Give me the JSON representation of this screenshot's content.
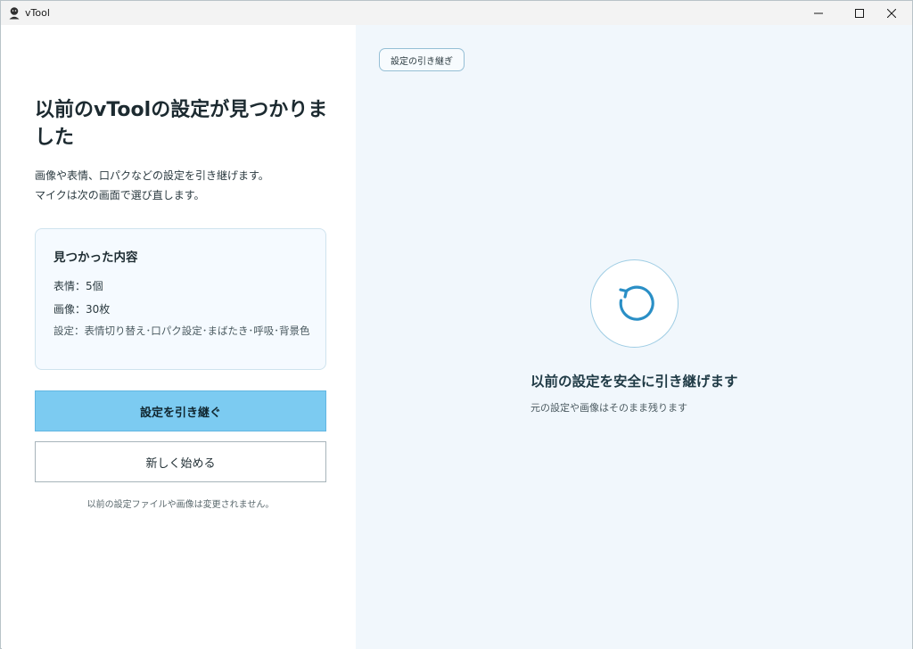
{
  "window": {
    "title": "vTool",
    "icon": "vtool-logo-icon",
    "controls": [
      "minimize-icon",
      "maximize-icon",
      "close-icon"
    ]
  },
  "left": {
    "heading": "以前のvToolの設定が見つかりました",
    "description": [
      "画像や表情、口パクなどの設定を引き継げます。",
      "マイクは次の画面で選び直します。"
    ],
    "found": {
      "title": "見つかった内容",
      "expressions": "表情：5個",
      "images": "画像：30枚",
      "settings": "設定：表情切り替え･口パク設定･まばたき･呼吸･背景色"
    },
    "primary_button": "設定を引き継ぐ",
    "secondary_button": "新しく始める",
    "note": "以前の設定ファイルや画像は変更されません。"
  },
  "right": {
    "tag": "設定の引き継ぎ",
    "icon": "restore-icon",
    "title": "以前の設定を安全に引き継げます",
    "subtitle": "元の設定や画像はそのまま残ります"
  },
  "colors": {
    "accent": "#7ccbf1",
    "accent_border": "#62b6e2",
    "panel_bg": "#f1f7fc",
    "icon_blue": "#2a8fc6"
  }
}
